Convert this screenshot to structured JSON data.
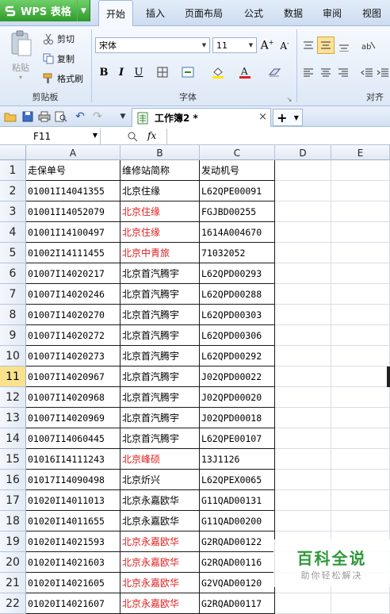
{
  "app": {
    "button_label": "WPS 表格",
    "logo_glyph": "S"
  },
  "menu": [
    "开始",
    "插入",
    "页面布局",
    "公式",
    "数据",
    "审阅",
    "视图"
  ],
  "ribbon": {
    "clipboard": {
      "paste": "粘贴",
      "cut": "剪切",
      "copy": "复制",
      "format_painter": "格式刷",
      "group": "剪贴板"
    },
    "font": {
      "name": "宋体",
      "size": "11",
      "bold": "B",
      "italic": "I",
      "underline": "U",
      "group": "字体"
    },
    "align": {
      "group": "对齐"
    }
  },
  "doc_tab": {
    "title": "工作簿2 *"
  },
  "formula_bar": {
    "cell_ref": "F11",
    "fx": "fx"
  },
  "columns": [
    "A",
    "B",
    "C",
    "D",
    "E"
  ],
  "selected_row": 11,
  "rows": [
    {
      "n": "1",
      "a": "走保单号",
      "b": "维修站简称",
      "c": "发动机号",
      "red": false
    },
    {
      "n": "2",
      "a": "01001I14041355",
      "b": "北京住缘",
      "c": "L62QPE00091",
      "red": false
    },
    {
      "n": "3",
      "a": "01001I14052079",
      "b": "北京住缘",
      "c": "FGJBD00255",
      "red": true
    },
    {
      "n": "4",
      "a": "01001I14100497",
      "b": "北京住缘",
      "c": "1614A004670",
      "red": true
    },
    {
      "n": "5",
      "a": "01002I14111455",
      "b": "北京中青旅",
      "c": "71032052",
      "red": true
    },
    {
      "n": "6",
      "a": "01007I14020217",
      "b": "北京首汽腾宇",
      "c": "L62QPD00293",
      "red": false
    },
    {
      "n": "7",
      "a": "01007I14020246",
      "b": "北京首汽腾宇",
      "c": "L62QPD00288",
      "red": false
    },
    {
      "n": "8",
      "a": "01007I14020270",
      "b": "北京首汽腾宇",
      "c": "L62QPD00303",
      "red": false
    },
    {
      "n": "9",
      "a": "01007I14020272",
      "b": "北京首汽腾宇",
      "c": "L62QPD00306",
      "red": false
    },
    {
      "n": "10",
      "a": "01007I14020273",
      "b": "北京首汽腾宇",
      "c": "L62QPD00292",
      "red": false
    },
    {
      "n": "11",
      "a": "01007I14020967",
      "b": "北京首汽腾宇",
      "c": "J02QPD00022",
      "red": false
    },
    {
      "n": "12",
      "a": "01007I14020968",
      "b": "北京首汽腾宇",
      "c": "J02QPD00020",
      "red": false
    },
    {
      "n": "13",
      "a": "01007I14020969",
      "b": "北京首汽腾宇",
      "c": "J02QPD00018",
      "red": false
    },
    {
      "n": "14",
      "a": "01007I14060445",
      "b": "北京首汽腾宇",
      "c": "L62QPE00107",
      "red": false
    },
    {
      "n": "15",
      "a": "01016I14111243",
      "b": "北京峰硕",
      "c": "13J1126",
      "red": true
    },
    {
      "n": "16",
      "a": "01017I14090498",
      "b": "北京炘兴",
      "c": "L62QPEX0065",
      "red": false
    },
    {
      "n": "17",
      "a": "01020I14011013",
      "b": "北京永嘉欧华",
      "c": "G11QAD00131",
      "red": false
    },
    {
      "n": "18",
      "a": "01020I14011655",
      "b": "北京永嘉欧华",
      "c": "G11QAD00200",
      "red": false
    },
    {
      "n": "19",
      "a": "01020I14021593",
      "b": "北京永嘉欧华",
      "c": "G2RQAD00122",
      "red": true
    },
    {
      "n": "20",
      "a": "01020I14021603",
      "b": "北京永嘉欧华",
      "c": "G2RQAD00116",
      "red": true
    },
    {
      "n": "21",
      "a": "01020I14021605",
      "b": "北京永嘉欧华",
      "c": "G2VQAD00120",
      "red": true
    },
    {
      "n": "22",
      "a": "01020I14021607",
      "b": "北京永嘉欧华",
      "c": "G2RQAD00117",
      "red": true
    }
  ],
  "watermark": {
    "title": "百科全说",
    "subtitle": "助你轻松解决"
  },
  "colors": {
    "red_text": "#e01e1e",
    "wps_green": "#3aa836",
    "watermark_green": "#2f9a3a"
  }
}
